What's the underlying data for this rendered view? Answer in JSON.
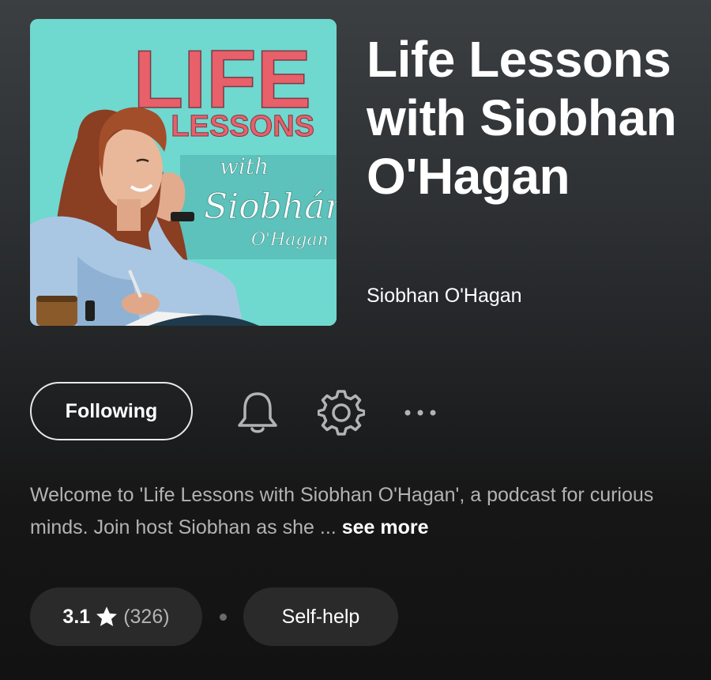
{
  "podcast": {
    "title": "Life Lessons with Siobhan O'Hagan",
    "author": "Siobhan O'Hagan",
    "cover": {
      "line1": "LIFE",
      "line2": "LESSONS",
      "line3": "with",
      "line4": "Siobhán",
      "line5": "O'Hagan",
      "bg_color": "#6fd8cf",
      "accent_color": "#e8606a"
    }
  },
  "actions": {
    "follow_label": "Following",
    "notifications_icon": "bell-icon",
    "settings_icon": "gear-icon",
    "more_icon": "more-horizontal-icon"
  },
  "description": {
    "text": "Welcome to 'Life Lessons with Siobhan O'Hagan', a podcast for curious minds. Join host Siobhan as she ...",
    "see_more_label": "see more"
  },
  "meta": {
    "rating": "3.1",
    "rating_count": "(326)",
    "star_icon": "star-icon",
    "genre": "Self-help"
  },
  "colors": {
    "text_primary": "#ffffff",
    "text_secondary": "#b3b3b3",
    "chip_bg": "#2a2a2a"
  }
}
